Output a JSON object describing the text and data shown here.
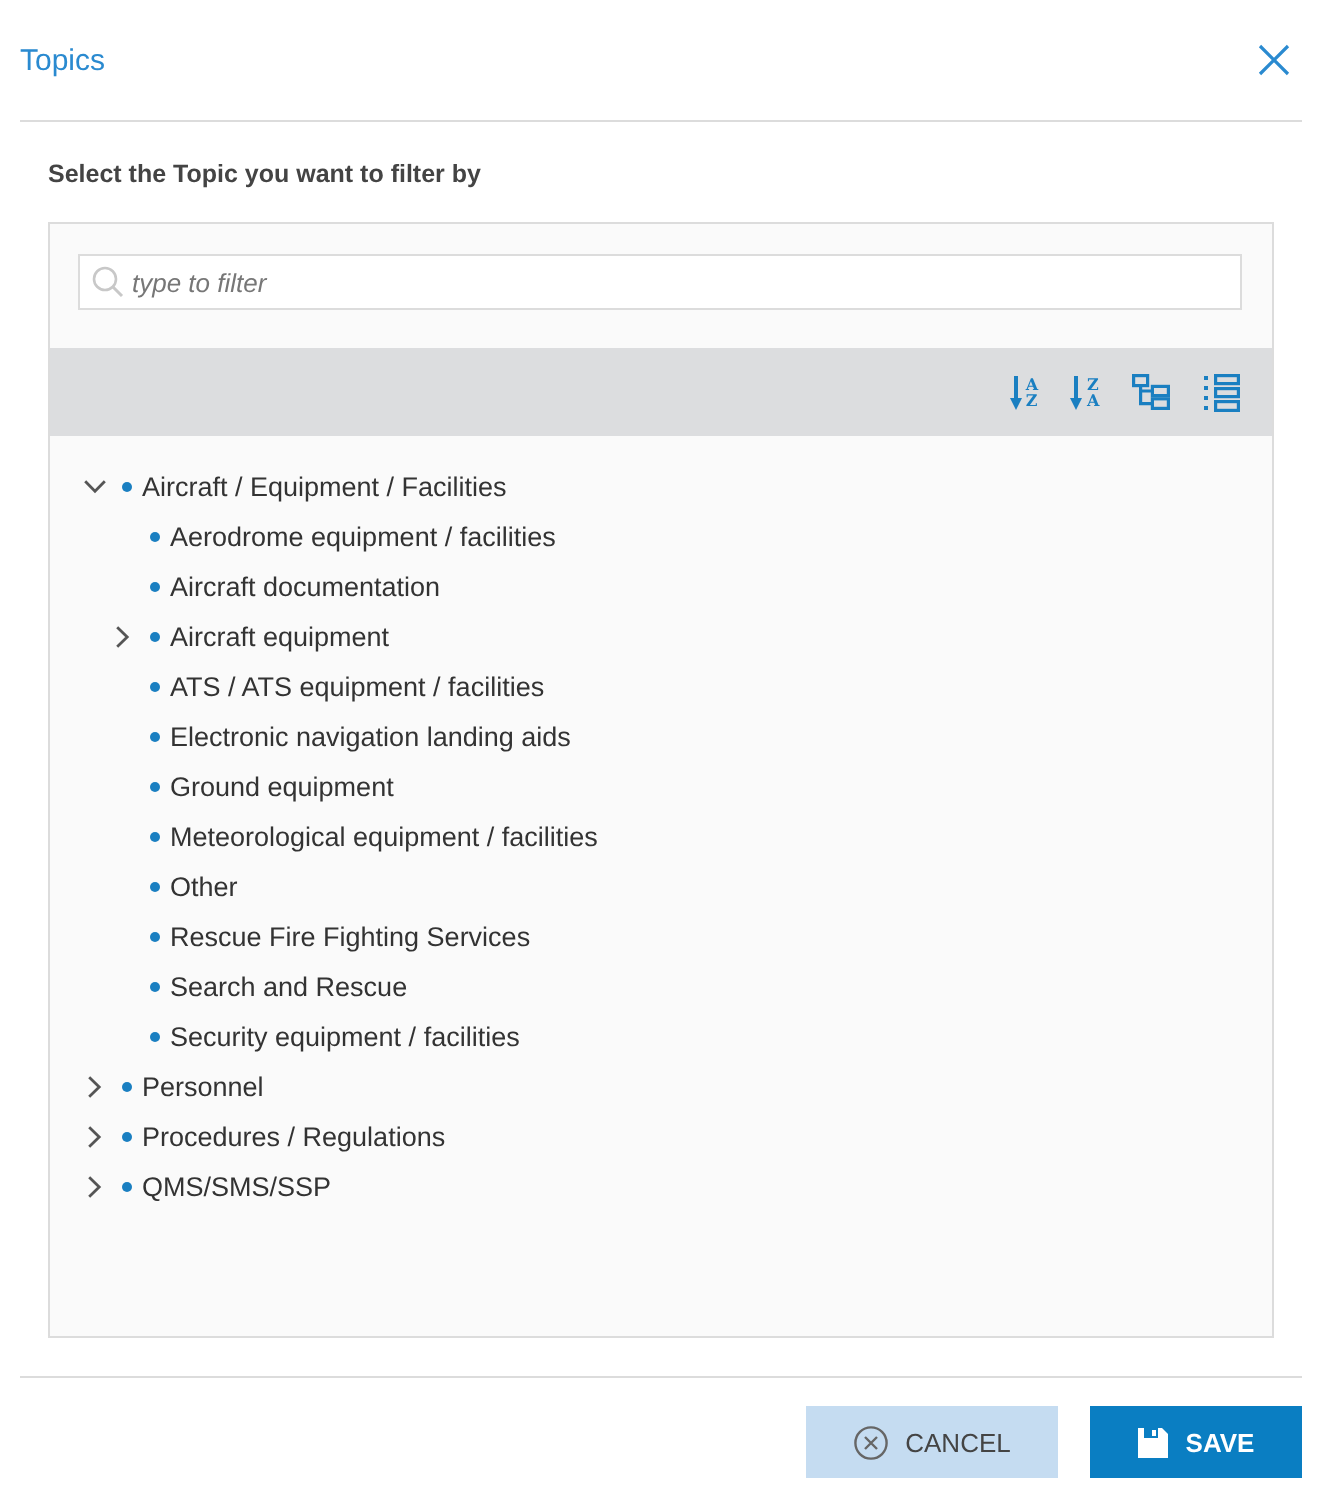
{
  "dialog": {
    "title": "Topics",
    "instruction": "Select the Topic you want to filter by"
  },
  "filter": {
    "placeholder": "type to filter"
  },
  "toolbar": [
    {
      "kind": "sort",
      "letters": "AZ"
    },
    {
      "kind": "sort",
      "letters": "ZA"
    },
    {
      "kind": "tree"
    },
    {
      "kind": "list"
    }
  ],
  "tree": [
    {
      "label": "Aircraft / Equipment / Facilities",
      "kind": "branch",
      "expanded": true,
      "children": [
        {
          "label": "Aerodrome equipment / facilities",
          "kind": "leaf"
        },
        {
          "label": "Aircraft documentation",
          "kind": "leaf"
        },
        {
          "label": "Aircraft equipment",
          "kind": "branch",
          "expanded": false
        },
        {
          "label": "ATS / ATS equipment / facilities",
          "kind": "leaf"
        },
        {
          "label": "Electronic navigation landing aids",
          "kind": "leaf"
        },
        {
          "label": "Ground equipment",
          "kind": "leaf"
        },
        {
          "label": "Meteorological equipment / facilities",
          "kind": "leaf"
        },
        {
          "label": "Other",
          "kind": "leaf"
        },
        {
          "label": "Rescue Fire Fighting Services",
          "kind": "leaf"
        },
        {
          "label": "Search and Rescue",
          "kind": "leaf"
        },
        {
          "label": "Security equipment / facilities",
          "kind": "leaf"
        }
      ]
    },
    {
      "label": "Personnel",
      "kind": "branch",
      "expanded": false
    },
    {
      "label": "Procedures / Regulations",
      "kind": "branch",
      "expanded": false
    },
    {
      "label": "QMS/SMS/SSP",
      "kind": "branch",
      "expanded": false
    }
  ],
  "buttons": [
    {
      "kind": "cancel",
      "label": "CANCEL"
    },
    {
      "kind": "save",
      "label": "SAVE"
    }
  ]
}
